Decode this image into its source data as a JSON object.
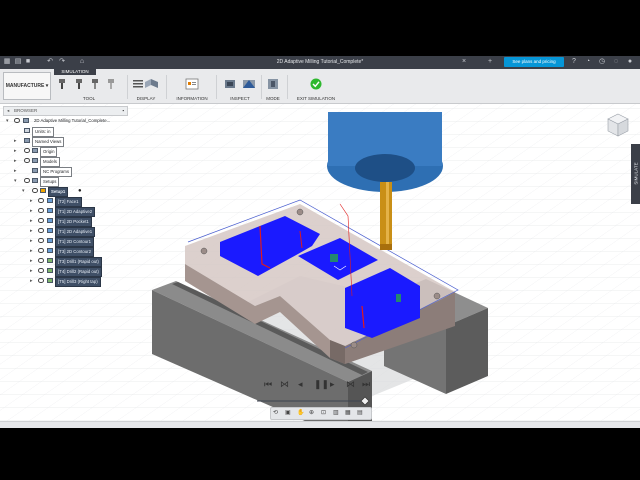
{
  "window": {
    "title": "2D Adaptive Milling Tutorial_Complete*"
  },
  "header": {
    "plans_button": "See plans and pricing"
  },
  "ribbon": {
    "workspace": "MANUFACTURE",
    "active_tab": "SIMULATION",
    "groups": [
      "TOOL",
      "DISPLAY",
      "INFORMATION",
      "INSPECT",
      "MODE",
      "EXIT SIMULATION"
    ],
    "exit_color": "#2eb82e"
  },
  "browser": {
    "title": "BROWSER",
    "root": "2D Adaptive Milling Tutorial_Complete...",
    "items": [
      "Units: in",
      "Named Views",
      "Origin",
      "Models",
      "NC Programs",
      "Setups"
    ],
    "setup": "Setup1",
    "operations": [
      "[T2] Face1",
      "[T1] 2D Adaptive2",
      "[T1] 2D Pocket1",
      "[T1] 2D Adaptive1",
      "[T1] 2D Contour1",
      "[T3] 2D Contour2",
      "[T3] Drill1 (Rapid out)",
      "[T4] Drill2 (Rapid out)",
      "[T5] Drill3 (Right tap)"
    ]
  },
  "side_tab": {
    "label": "SIMULATE"
  },
  "colors": {
    "stock_blue": "#1a1aff",
    "tool_holder": "#2e6fb3",
    "tool": "#c98f16",
    "accent": "#0696d7"
  }
}
